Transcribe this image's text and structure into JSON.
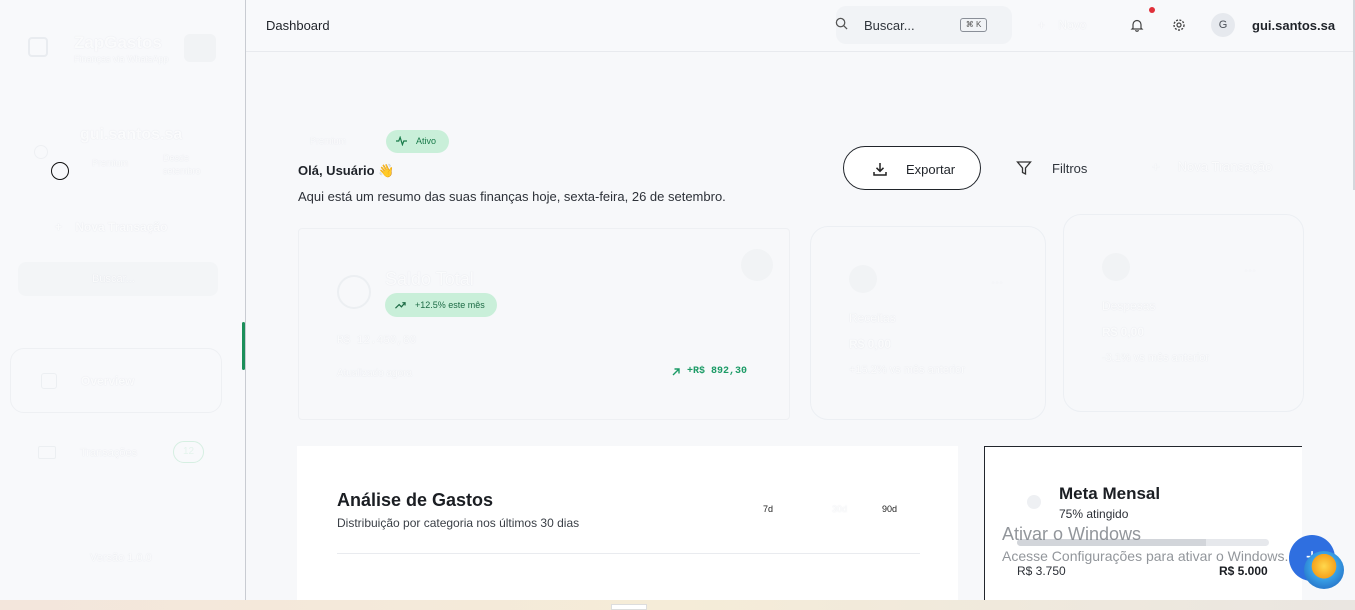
{
  "sidebar": {
    "app_name": "ZapGastos",
    "app_tagline": "Finanças via WhatsApp",
    "user_name": "gui.santos.sa",
    "plan": "Premium",
    "member_since": "Desde setembro",
    "new_transaction": "Nova Transação",
    "search_placeholder": "Buscar...",
    "search_shortcut": "⌘K",
    "nav": [
      {
        "label": "Overview",
        "active": true
      },
      {
        "label": "Transações",
        "badge": "12"
      }
    ],
    "version": "Versão 1.0.0"
  },
  "header": {
    "title": "Dashboard",
    "search_placeholder": "Buscar...",
    "search_shortcut": "⌘ K",
    "new_label": "Novo",
    "avatar_initial": "G",
    "user_name": "gui.santos.sa",
    "has_notification": true
  },
  "hero": {
    "crumb": "Premium",
    "status": "Ativo",
    "greeting": "Olá, Usuário 👋",
    "subtitle": "Aqui está um resumo das suas finanças hoje, sexta-feira, 26 de setembro.",
    "export_label": "Exportar",
    "filter_label": "Filtros",
    "new_tx_label": "Nova Transação"
  },
  "cards": {
    "saldo": {
      "title": "Saldo Total",
      "growth": "+12.5% este mês",
      "value": "R$ 12.450,80",
      "label": "Atualizado agora",
      "delta": "+R$ 892,30"
    },
    "receitas": {
      "title": "Receitas",
      "value": "R$ 0,00",
      "delta": "+15.2% vs mês anterior",
      "menu": "···"
    },
    "despesas": {
      "title": "Despesas",
      "value": "R$ 0,00",
      "delta": "-3.1% vs mês anterior",
      "menu": "···"
    }
  },
  "analysis": {
    "title": "Análise de Gastos",
    "subtitle": "Distribuição por categoria nos últimos 30 dias",
    "ranges": [
      "7d",
      "30d",
      "90d"
    ],
    "active_range": "30d"
  },
  "goal": {
    "title": "Meta Mensal",
    "subtitle": "75% atingido",
    "progress": 0.75,
    "current": "R$ 3.750",
    "target": "R$ 5.000"
  },
  "overlay": {
    "activate_title": "Ativar o Windows",
    "activate_sub": "Acesse Configurações para ativar o Windows.",
    "fab_label": "+"
  },
  "colors": {
    "accent": "#1c8f5a",
    "badge_bg": "#c9efd9",
    "notification": "#e0303a",
    "fab": "#2f6fe0"
  }
}
